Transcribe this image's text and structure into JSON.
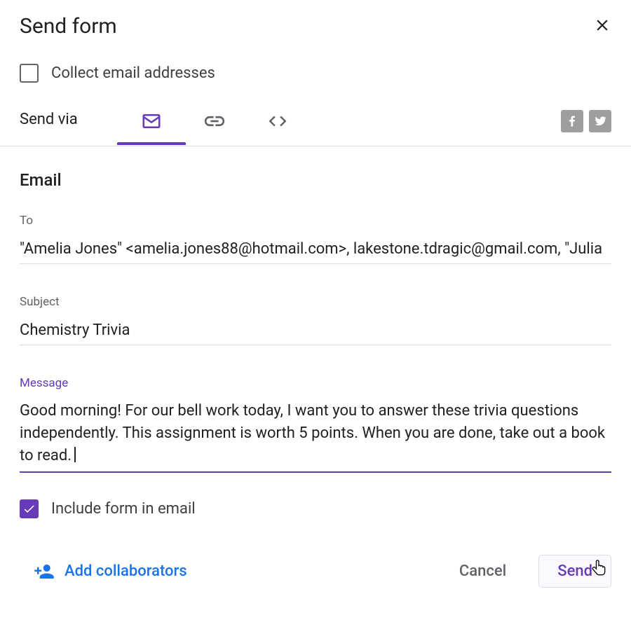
{
  "dialog": {
    "title": "Send form",
    "collect_label": "Collect email addresses",
    "collect_checked": false,
    "send_via_label": "Send via",
    "tabs": {
      "active": "email"
    },
    "social": [
      "facebook",
      "twitter"
    ]
  },
  "email": {
    "section_title": "Email",
    "to_label": "To",
    "to_value": "\"Amelia Jones\" <amelia.jones88@hotmail.com>, lakestone.tdragic@gmail.com, \"Julia",
    "subject_label": "Subject",
    "subject_value": "Chemistry Trivia",
    "message_label": "Message",
    "message_value": "Good morning! For our bell work today, I want you to answer these trivia questions independently. This assignment is worth 5 points. When you are done, take out a book to read.",
    "include_label": "Include form in email",
    "include_checked": true
  },
  "footer": {
    "collab_label": "Add collaborators",
    "cancel_label": "Cancel",
    "send_label": "Send"
  }
}
